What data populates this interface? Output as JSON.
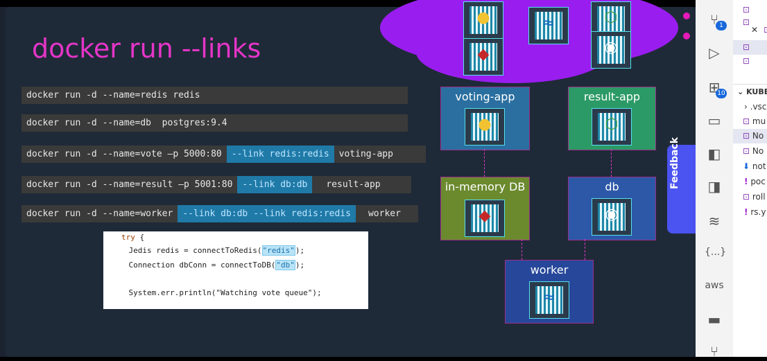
{
  "slide": {
    "title": "docker run --links",
    "commands": [
      {
        "parts": [
          "docker run -d --name=redis redis"
        ],
        "links": []
      },
      {
        "parts": [
          "docker run -d --name=db  postgres:9.4"
        ],
        "links": []
      },
      {
        "parts": [
          "docker run -d --name=vote –p 5000:80",
          "--link redis:redis",
          "voting-app"
        ],
        "links": [
          1
        ]
      },
      {
        "parts": [
          "docker run -d --name=result –p 5001:80",
          "--link db:db",
          "result-app"
        ],
        "links": [
          1
        ]
      },
      {
        "parts": [
          "docker run -d --name=worker",
          "--link db:db --link redis:redis",
          "worker"
        ],
        "links": [
          1
        ]
      }
    ],
    "code": {
      "line1_kw": "try",
      "line1_rest": " {",
      "line2_pre": "    Jedis redis = connectToRedis(",
      "line2_str": "\"redis\"",
      "line2_post": ");",
      "line3_pre": "    Connection dbConn = connectToDB(",
      "line3_str": "\"db\"",
      "line3_post": ");",
      "line4": "    System.err.println(\"Watching vote queue\");"
    },
    "diagram": {
      "voting_app": "voting-app",
      "result_app": "result-app",
      "in_memory_db": "in-memory DB",
      "db": "db",
      "worker": "worker",
      "colors": {
        "voting": "#2a6fa0",
        "result": "#2c9a66",
        "memory": "#6b8a2e",
        "db": "#2d58a8",
        "worker": "#27489a",
        "cloud": "#9a1df0"
      }
    }
  },
  "feedback": {
    "label": "Feedback"
  },
  "activity_bar": {
    "items": [
      {
        "name": "source-control-icon",
        "badge": "1"
      },
      {
        "name": "run-debug-icon",
        "badge": ""
      },
      {
        "name": "extensions-icon",
        "badge": "10"
      },
      {
        "name": "remote-explorer-icon",
        "badge": ""
      },
      {
        "name": "terraform-icon",
        "badge": ""
      },
      {
        "name": "terraform-cloud-icon",
        "badge": ""
      },
      {
        "name": "docker-icon",
        "badge": ""
      },
      {
        "name": "json-icon",
        "label": "{...}"
      },
      {
        "name": "aws-icon",
        "label": "aws"
      },
      {
        "name": "folder-icon",
        "badge": ""
      },
      {
        "name": "git-graph-icon",
        "badge": ""
      }
    ]
  },
  "explorer": {
    "section": "KUBER",
    "items": [
      ".vsc",
      "mu",
      "No",
      "No",
      "not",
      "poc",
      "roll",
      "rs.y"
    ]
  }
}
